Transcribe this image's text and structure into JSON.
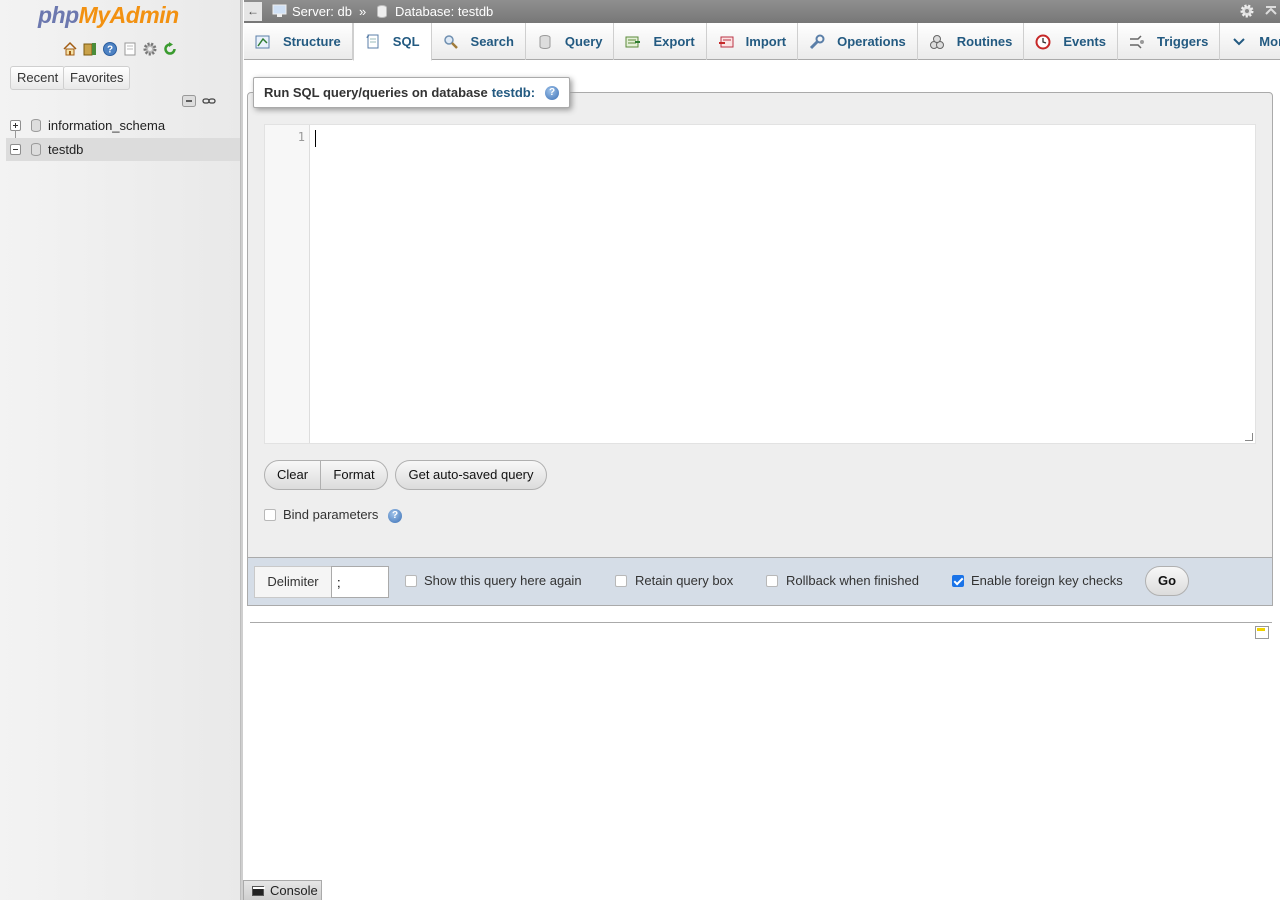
{
  "nav": {
    "logo_php": "php",
    "logo_myadmin": "MyAdmin",
    "tabs": [
      "Recent",
      "Favorites"
    ],
    "databases": [
      {
        "name": "information_schema",
        "expanded": false
      },
      {
        "name": "testdb",
        "expanded": true,
        "selected": true
      }
    ],
    "icons": [
      "home-icon",
      "logout-icon",
      "help-icon",
      "docs-icon",
      "settings-icon",
      "reload-icon"
    ]
  },
  "topbar": {
    "back": "←",
    "server": "Server: db",
    "separator": "»",
    "database": "Database: testdb"
  },
  "tabs": [
    {
      "label": "Structure",
      "icon": "structure-icon"
    },
    {
      "label": "SQL",
      "icon": "sql-icon",
      "active": true
    },
    {
      "label": "Search",
      "icon": "search-icon"
    },
    {
      "label": "Query",
      "icon": "query-icon"
    },
    {
      "label": "Export",
      "icon": "export-icon"
    },
    {
      "label": "Import",
      "icon": "import-icon"
    },
    {
      "label": "Operations",
      "icon": "operations-icon"
    },
    {
      "label": "Routines",
      "icon": "routines-icon"
    },
    {
      "label": "Events",
      "icon": "events-icon"
    },
    {
      "label": "Triggers",
      "icon": "triggers-icon"
    },
    {
      "label": "More",
      "icon": "chevron-down-icon"
    }
  ],
  "sql": {
    "legend_prefix": "Run SQL query/queries on database",
    "legend_db": "testdb:",
    "line_number": "1",
    "query": "",
    "buttons": {
      "clear": "Clear",
      "format": "Format",
      "autosaved": "Get auto-saved query"
    },
    "bind_parameters": "Bind parameters"
  },
  "footer": {
    "delimiter_label": "Delimiter",
    "delimiter_value": ";",
    "show_query": "Show this query here again",
    "retain_box": "Retain query box",
    "rollback": "Rollback when finished",
    "fk_checks": "Enable foreign key checks",
    "fk_checks_checked": true,
    "go": "Go"
  },
  "console": {
    "label": "Console"
  },
  "colors": {
    "link": "#235a81",
    "logo_blue": "#6c78af",
    "logo_orange": "#f29111",
    "checkbox_checked": "#1a73e8"
  }
}
